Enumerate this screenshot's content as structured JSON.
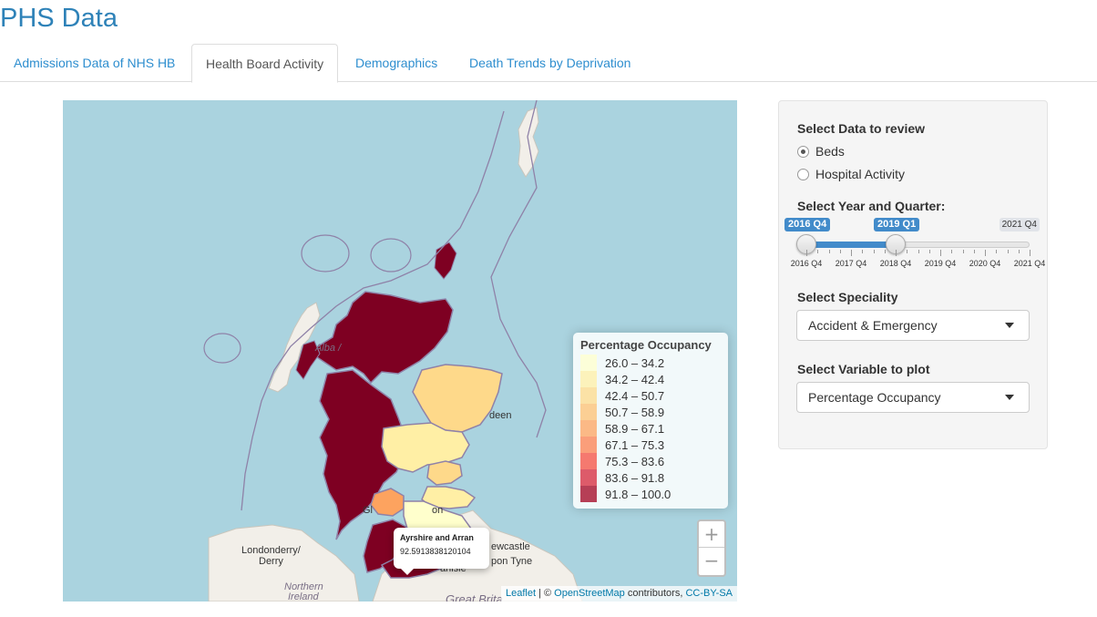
{
  "app": {
    "title": "PHS Data"
  },
  "tabs": [
    {
      "label": "Admissions Data of NHS HB",
      "active": false
    },
    {
      "label": "Health Board Activity",
      "active": true
    },
    {
      "label": "Demographics",
      "active": false
    },
    {
      "label": "Death Trends by Deprivation",
      "active": false
    }
  ],
  "map": {
    "place_labels": {
      "alba": "Alba /",
      "aberdeen": "deen",
      "glasgow": "Gl",
      "edinburgh": "on",
      "newcastle": "ewcastle",
      "tyne": "pon Tyne",
      "londonderry": "Londonderry/",
      "derry": "Derry",
      "northern": "Northern",
      "ireland": "Ireland",
      "carlisle": "arlisle",
      "great_britain": "Great Brita"
    },
    "legend": {
      "title": "Percentage Occupancy",
      "bins": [
        {
          "label": "26.0 – 34.2",
          "color": "#ffffcc"
        },
        {
          "label": "34.2 – 42.4",
          "color": "#ffefa5"
        },
        {
          "label": "42.4 – 50.7",
          "color": "#fed98a"
        },
        {
          "label": "50.7 – 58.9",
          "color": "#fec072"
        },
        {
          "label": "58.9 – 67.1",
          "color": "#fda35f"
        },
        {
          "label": "67.1 – 75.3",
          "color": "#fc7f4f"
        },
        {
          "label": "75.3 – 83.6",
          "color": "#f54d40"
        },
        {
          "label": "83.6 – 91.8",
          "color": "#d5253a"
        },
        {
          "label": "91.8 – 100.0",
          "color": "#a2001f"
        }
      ]
    },
    "popup": {
      "name": "Ayrshire and Arran",
      "value": "92.5913838120104"
    },
    "zoom": {
      "in": "+",
      "out": "−"
    },
    "attribution": {
      "leaflet": "Leaflet",
      "sep": " | © ",
      "osm": "OpenStreetMap",
      "contrib": " contributors, ",
      "license": "CC-BY-SA"
    },
    "colors": {
      "sea": "#aad3df",
      "land": "#f2efe9",
      "dark_region": "#7e0022",
      "grampian": "#fed98a",
      "highland_east": "#ffefa5",
      "lothian": "#ffefa5",
      "pale": "#ffffcc",
      "glasgow": "#fda35f",
      "border": "#8f82a8"
    }
  },
  "panel": {
    "data_label": "Select Data to review",
    "radios": [
      {
        "label": "Beds",
        "checked": true
      },
      {
        "label": "Hospital Activity",
        "checked": false
      }
    ],
    "slider": {
      "label": "Select Year and Quarter:",
      "from": "2016 Q4",
      "to": "2019 Q1",
      "max": "2021 Q4",
      "from_fraction": 0.0,
      "to_fraction": 0.4,
      "ticks": [
        "2016 Q4",
        "2017 Q4",
        "2018 Q4",
        "2019 Q4",
        "2020 Q4",
        "2021 Q4"
      ]
    },
    "speciality": {
      "label": "Select Speciality",
      "value": "Accident & Emergency"
    },
    "variable": {
      "label": "Select Variable to plot",
      "value": "Percentage Occupancy"
    }
  }
}
